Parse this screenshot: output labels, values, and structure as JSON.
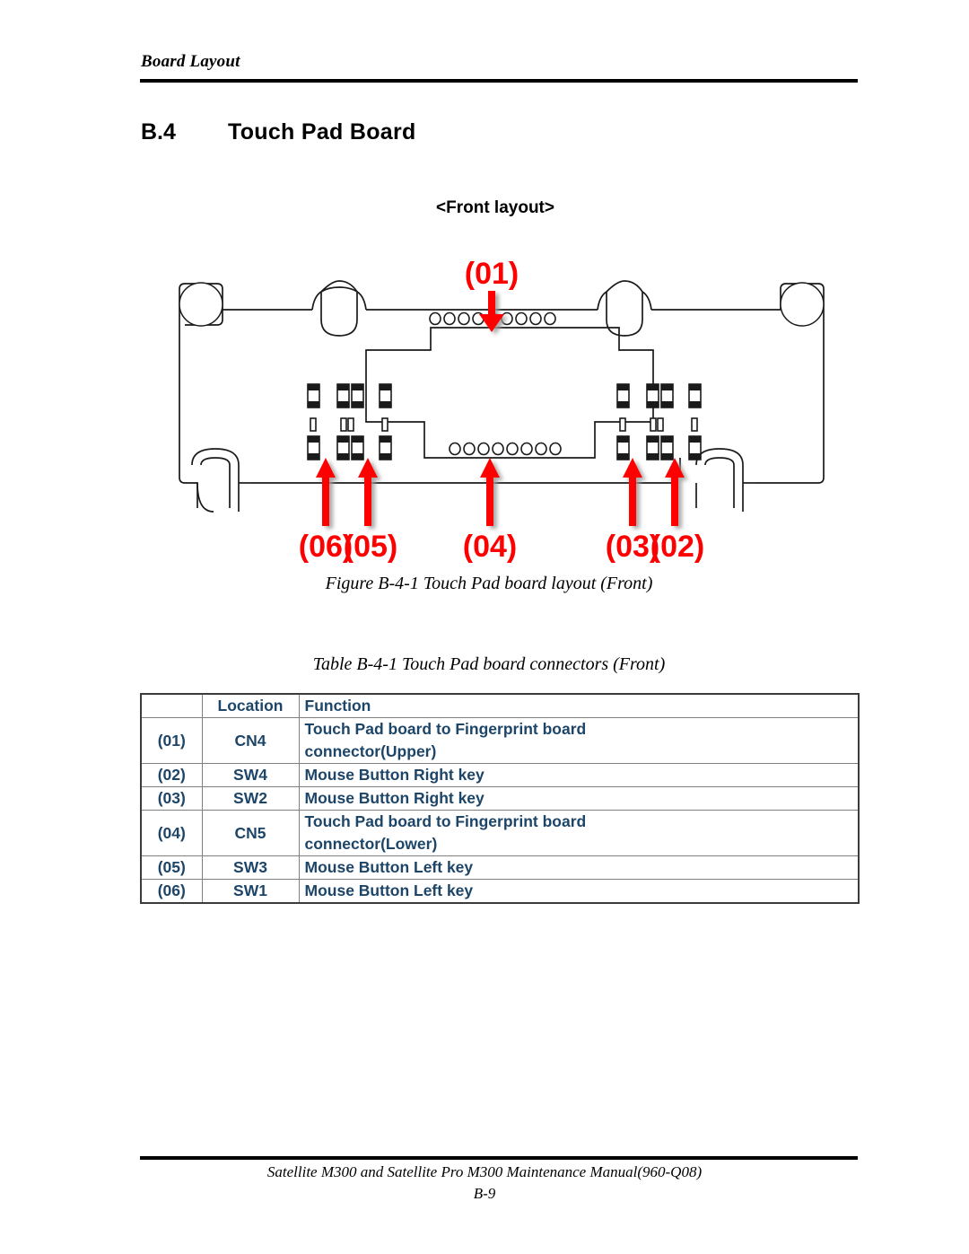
{
  "header": {
    "running_head": "Board Layout"
  },
  "section": {
    "number": "B.4",
    "title": "Touch Pad Board"
  },
  "figure": {
    "view_label": "<Front layout>",
    "caption": "Figure B-4-1 Touch Pad board layout (Front)",
    "callouts": [
      {
        "id": "01",
        "label": "(01)",
        "direction": "down"
      },
      {
        "id": "02",
        "label": "(02)",
        "direction": "up"
      },
      {
        "id": "03",
        "label": "(03)",
        "direction": "up"
      },
      {
        "id": "04",
        "label": "(04)",
        "direction": "up"
      },
      {
        "id": "05",
        "label": "(05)",
        "direction": "up"
      },
      {
        "id": "06",
        "label": "(06)",
        "direction": "up"
      }
    ],
    "callout_color": "#ff0000",
    "outline_color": "#000000"
  },
  "table": {
    "caption": "Table B-4-1 Touch Pad board connectors (Front)",
    "text_color": "#1d4568",
    "columns": [
      "",
      "Location",
      "Function"
    ],
    "rows": [
      {
        "index": "(01)",
        "location": "CN4",
        "function_line1": "Touch Pad board to Fingerprint board",
        "function_line2": "connector(Upper)"
      },
      {
        "index": "(02)",
        "location": "SW4",
        "function_line1": "Mouse Button Right key",
        "function_line2": ""
      },
      {
        "index": "(03)",
        "location": "SW2",
        "function_line1": "Mouse Button Right key",
        "function_line2": ""
      },
      {
        "index": "(04)",
        "location": "CN5",
        "function_line1": "Touch Pad board to Fingerprint board",
        "function_line2": "connector(Lower)"
      },
      {
        "index": "(05)",
        "location": "SW3",
        "function_line1": "Mouse Button Left key",
        "function_line2": ""
      },
      {
        "index": "(06)",
        "location": "SW1",
        "function_line1": "Mouse Button Left key",
        "function_line2": ""
      }
    ]
  },
  "footer": {
    "manual": "Satellite M300 and Satellite Pro M300 Maintenance Manual(960-Q08)",
    "page": "B-9"
  }
}
